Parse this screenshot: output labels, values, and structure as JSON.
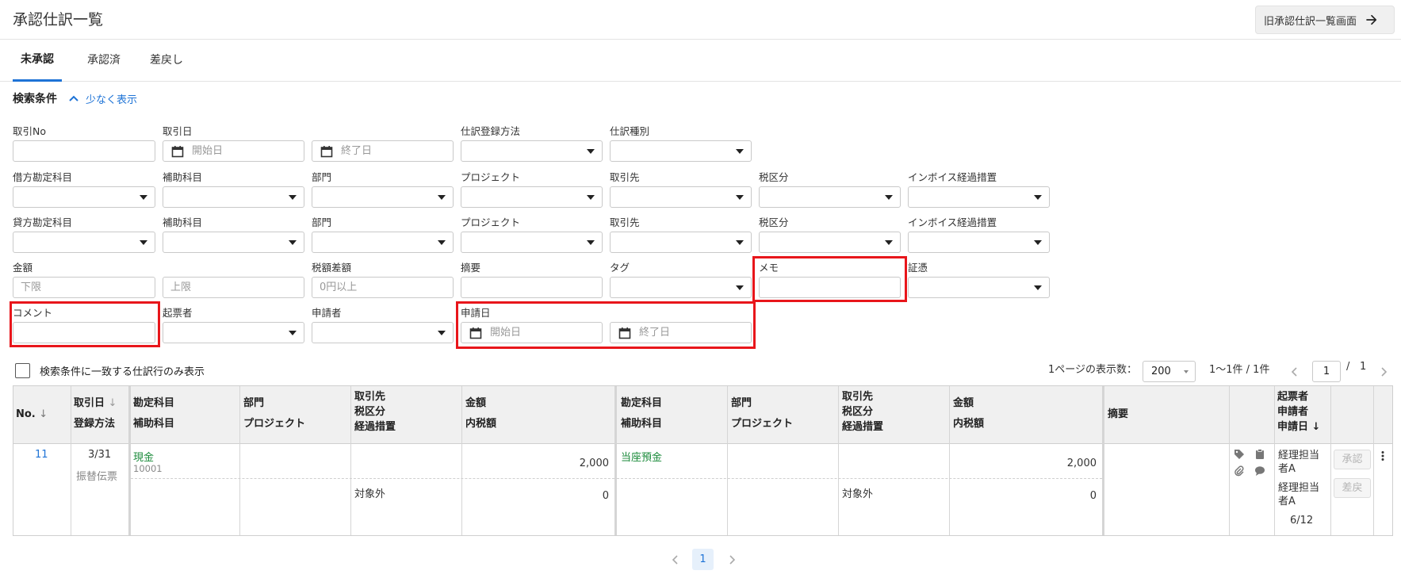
{
  "header": {
    "title": "承認仕訳一覧",
    "old_screen_button": "旧承認仕訳一覧画面"
  },
  "tabs": [
    "未承認",
    "承認済",
    "差戻し"
  ],
  "search": {
    "title": "検索条件",
    "toggle_label": "少なく表示",
    "row1": {
      "torihiki_no": "取引No",
      "torihiki_date": "取引日",
      "start_placeholder": "開始日",
      "end_placeholder": "終了日",
      "entry_method": "仕訳登録方法",
      "entry_type": "仕訳種別"
    },
    "debit": {
      "account": "借方勘定科目",
      "sub_account": "補助科目",
      "dept": "部門",
      "project": "プロジェクト",
      "partner": "取引先",
      "tax": "税区分",
      "invoice": "インボイス経過措置"
    },
    "credit": {
      "account": "貸方勘定科目",
      "sub_account": "補助科目",
      "dept": "部門",
      "project": "プロジェクト",
      "partner": "取引先",
      "tax": "税区分",
      "invoice": "インボイス経過措置"
    },
    "row4": {
      "amount": "金額",
      "lower_placeholder": "下限",
      "upper_placeholder": "上限",
      "tax_diff": "税額差額",
      "tax_diff_placeholder": "0円以上",
      "summary": "摘要",
      "tag": "タグ",
      "memo": "メモ",
      "evidence": "証憑"
    },
    "row5": {
      "comment": "コメント",
      "issuer": "起票者",
      "applicant": "申請者",
      "apply_date": "申請日",
      "start_placeholder": "開始日",
      "end_placeholder": "終了日"
    },
    "match_only": "検索条件に一致する仕訳行のみ表示"
  },
  "pagination": {
    "per_page_label": "1ページの表示数：",
    "per_page_value": "200",
    "range": "1〜1件 / 1件",
    "current": "1",
    "slash": "/",
    "total_pages": "1"
  },
  "table": {
    "headers": {
      "no": "No.",
      "date": "取引日",
      "method": "登録方法",
      "d_account": "勘定科目",
      "d_sub": "補助科目",
      "d_dept": "部門",
      "d_project": "プロジェクト",
      "d_partner": "取引先",
      "d_tax": "税区分",
      "d_measure": "経過措置",
      "d_amount": "金額",
      "d_tax_amount": "内税額",
      "c_account": "勘定科目",
      "c_sub": "補助科目",
      "c_dept": "部門",
      "c_project": "プロジェクト",
      "c_partner": "取引先",
      "c_tax": "税区分",
      "c_measure": "経過措置",
      "c_amount": "金額",
      "c_tax_amount": "内税額",
      "summary": "摘要",
      "issuer": "起票者",
      "applicant": "申請者",
      "apply_date": "申請日"
    },
    "rows": [
      {
        "no": "11",
        "date": "3/31",
        "method": "振替伝票",
        "d_account": "現金",
        "d_sub_code": "10001",
        "d_amount": "2,000",
        "d_tax": "対象外",
        "d_tax_amount": "0",
        "c_account": "当座預金",
        "c_amount": "2,000",
        "c_tax": "対象外",
        "c_tax_amount": "0",
        "issuer": "経理担当者A",
        "applicant": "経理担当者A",
        "apply_date": "6/12",
        "approve": "承認",
        "reject": "差戻"
      }
    ]
  },
  "bottom_pager": {
    "current": "1"
  },
  "colors": {
    "accent": "#1e73d6",
    "highlight": "#e8161b",
    "account_green": "#1a8a3a"
  }
}
